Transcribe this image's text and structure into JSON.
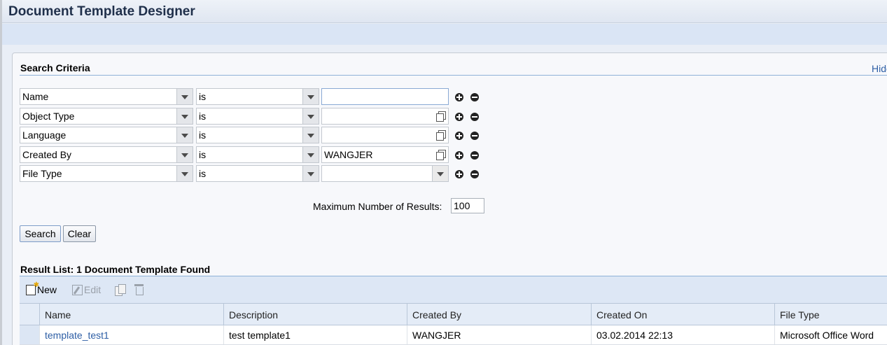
{
  "header": {
    "title": "Document Template Designer"
  },
  "search_criteria": {
    "title": "Search Criteria",
    "hide_label": "Hide",
    "rows": [
      {
        "field": "Name",
        "operator": "is",
        "value": ""
      },
      {
        "field": "Object Type",
        "operator": "is",
        "value": ""
      },
      {
        "field": "Language",
        "operator": "is",
        "value": ""
      },
      {
        "field": "Created By",
        "operator": "is",
        "value": "WANGJER"
      },
      {
        "field": "File Type",
        "operator": "is",
        "value": ""
      }
    ],
    "max_results_label": "Maximum Number of Results:",
    "max_results_value": "100",
    "search_button": "Search",
    "clear_button": "Clear"
  },
  "result_list": {
    "title": "Result List: 1 Document Template Found",
    "toolbar": {
      "new": "New",
      "edit": "Edit"
    },
    "columns": [
      "Name",
      "Description",
      "Created By",
      "Created On",
      "File Type"
    ],
    "rows": [
      [
        "template_test1",
        "test template1",
        "WANGJER",
        "03.02.2014 22:13",
        "Microsoft Office Word"
      ]
    ]
  }
}
